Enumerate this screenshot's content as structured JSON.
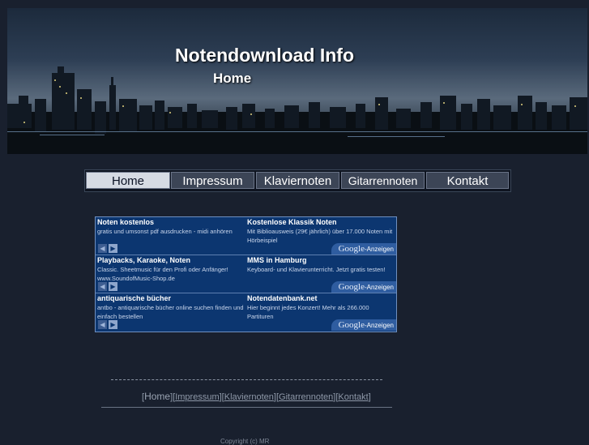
{
  "header": {
    "title": "Notendownload Info",
    "subtitle": "Home"
  },
  "nav": {
    "items": [
      {
        "label": "Home",
        "active": true
      },
      {
        "label": "Impressum"
      },
      {
        "label": "Klaviernoten"
      },
      {
        "label": "Gitarrennoten"
      },
      {
        "label": "Kontakt"
      }
    ]
  },
  "ads": {
    "badge_google": "Google",
    "badge_label": "-Anzeigen",
    "rows": [
      [
        {
          "title": "Noten kostenlos",
          "text": "gratis und umsonst pdf ausdrucken - midi anhören"
        },
        {
          "title": "Kostenlose Klassik Noten",
          "text": "Mit Biblioausweis (29€ jährlich) über 17.000 Noten mit Hörbeispiel"
        }
      ],
      [
        {
          "title": "Playbacks, Karaoke, Noten",
          "text": "Classic. Sheetmusic für den Profi oder Anfänger! www.SoundofMusic-Shop.de"
        },
        {
          "title": "MMS in Hamburg",
          "text": "Keyboard- und Klavierunterricht. Jetzt gratis testen!"
        }
      ],
      [
        {
          "title": "antiquarische bücher",
          "text": "antbo - antiquarische bücher online suchen finden und einfach bestellen"
        },
        {
          "title": "Notendatenbank.net",
          "text": "Hier beginnt jedes Konzert! Mehr als 266.000 Partituren"
        }
      ]
    ]
  },
  "footer": {
    "nav_current": "Home",
    "nav_links": [
      "Impressum",
      "Klaviernoten",
      "Gitarrennoten",
      "Kontakt"
    ],
    "copyright": "Copyright (c) MR"
  }
}
